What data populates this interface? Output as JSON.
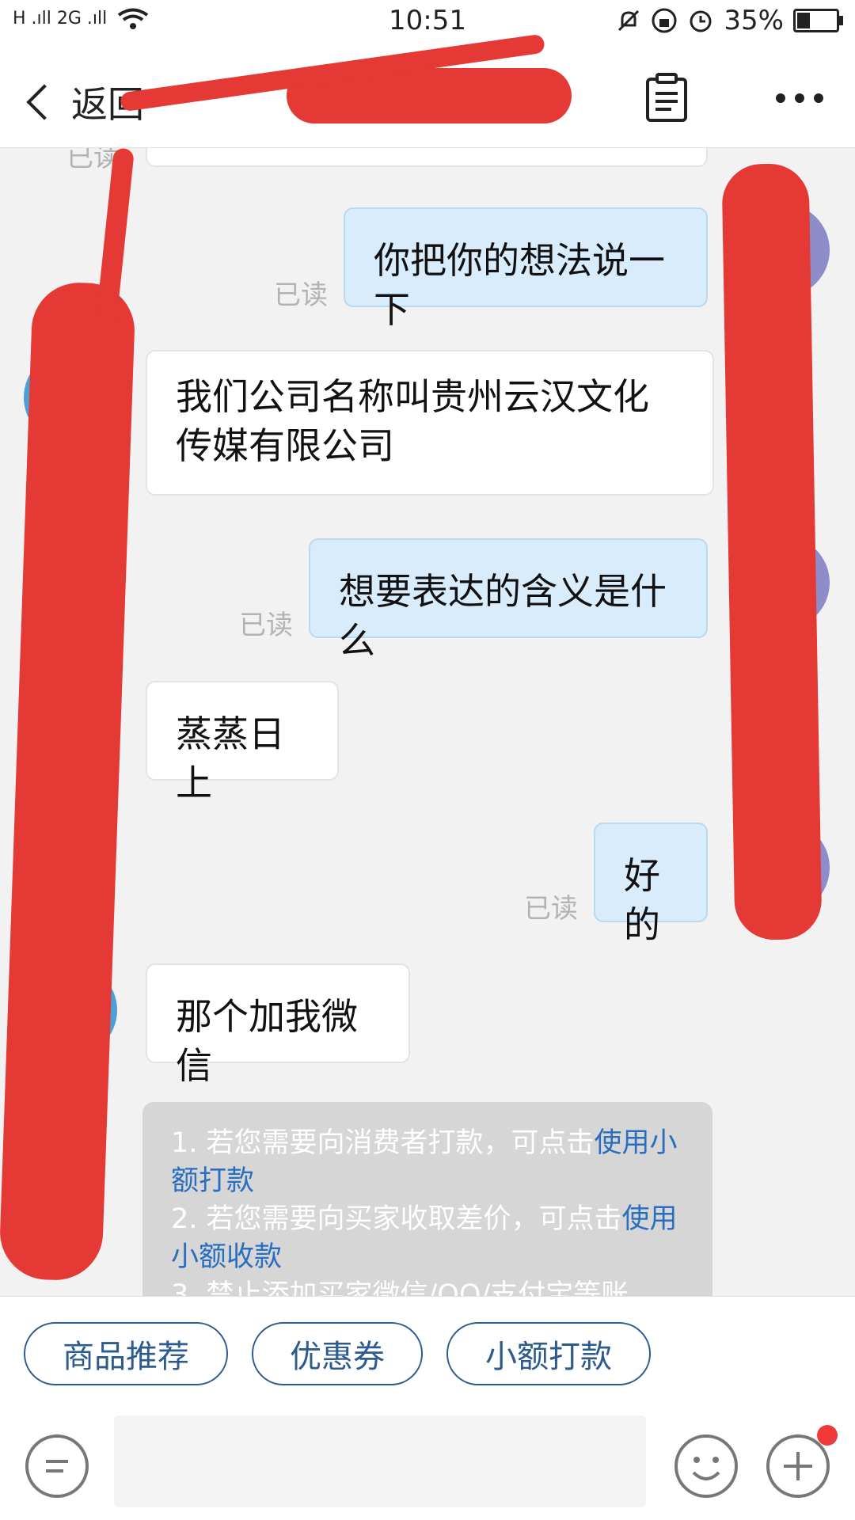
{
  "status_bar": {
    "time": "10:51",
    "signal": "H .ıll 2G .ıll",
    "battery": "35%"
  },
  "header": {
    "back_label": "返回"
  },
  "messages": {
    "top_read": "已读",
    "m1_text": "你把你的想法说一下",
    "m1_read": "已读",
    "m2_text": "我们公司名称叫贵州云汉文化传媒有限公司",
    "m3_text": "想要表达的含义是什么",
    "m3_read": "已读",
    "m4_text": "蒸蒸日上",
    "m5_text": "好的",
    "m5_read": "已读",
    "m6_text": "那个加我微信"
  },
  "notice": {
    "line1_prefix": "1. 若您需要向消费者打款，可点击",
    "line1_link": "使用小额打款",
    "line2_prefix": "2. 若您需要向买家收取差价，可点击",
    "line2_link": "使用小额收款",
    "line3": "3. 禁止添加买家微信/QQ/支付宝等账"
  },
  "quick_replies": [
    "商品推荐",
    "优惠券",
    "小额打款"
  ],
  "colors": {
    "my_bubble": "#d8ecfb",
    "their_bubble": "#ffffff",
    "accent": "#2d5b8e",
    "link": "#2a6ebf",
    "redaction": "#e53935",
    "badge": "#f03a3a"
  },
  "icons": [
    "back-chevron-icon",
    "notes-icon",
    "more-icon",
    "voice-icon",
    "emoji-icon",
    "plus-icon",
    "mute-bell-icon",
    "rotation-lock-icon",
    "alarm-icon",
    "wifi-icon",
    "battery-icon"
  ]
}
